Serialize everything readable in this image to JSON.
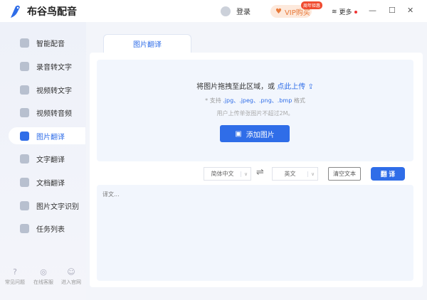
{
  "app": {
    "title": "布谷鸟配音"
  },
  "titlebar": {
    "login": "登录",
    "vip": "VIP购买",
    "vip_badge": "周年钜惠",
    "more": "更多",
    "minimize": "—",
    "maximize": "☐",
    "close": "✕"
  },
  "sidebar": {
    "items": [
      {
        "label": "智能配音"
      },
      {
        "label": "录音转文字"
      },
      {
        "label": "视频转文字"
      },
      {
        "label": "视频转音频"
      },
      {
        "label": "图片翻译",
        "active": true
      },
      {
        "label": "文字翻译"
      },
      {
        "label": "文档翻译"
      },
      {
        "label": "图片文字识别"
      },
      {
        "label": "任务列表"
      }
    ],
    "footer": [
      {
        "label": "常见问题",
        "icon": "?"
      },
      {
        "label": "在线客服",
        "icon": "◎"
      },
      {
        "label": "进入官网",
        "icon": "☺"
      }
    ]
  },
  "main": {
    "tab": "图片翻译",
    "upload": {
      "prompt": "将图片拖拽至此区域，或",
      "link": "点此上传",
      "support_prefix": "* 支持",
      "formats": ".jpg、.jpeg、.png、.bmp",
      "support_suffix": "格式",
      "limit": "用户上传单张图片不超过2M。",
      "add_button": "添加图片"
    },
    "source_lang": "简体中文",
    "target_lang": "英文",
    "swap": "⇌",
    "clear": "清空文本",
    "translate": "翻 译",
    "output_placeholder": "译文..."
  }
}
